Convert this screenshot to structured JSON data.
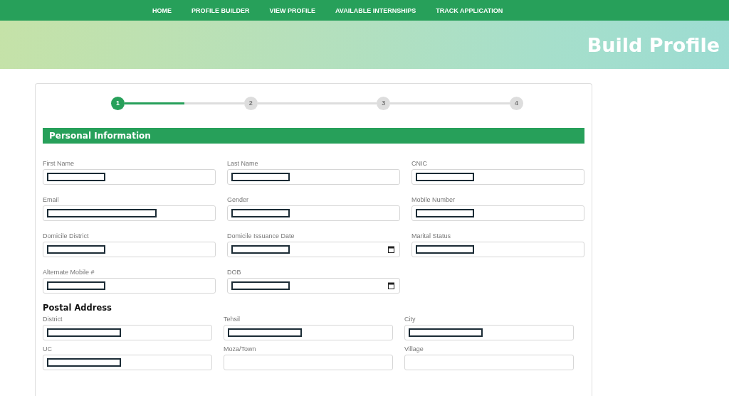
{
  "nav": {
    "items": [
      {
        "label": "HOME"
      },
      {
        "label": "PROFILE BUILDER"
      },
      {
        "label": "VIEW PROFILE"
      },
      {
        "label": "AVAILABLE INTERNSHIPS"
      },
      {
        "label": "TRACK APPLICATION"
      }
    ]
  },
  "banner": {
    "title": "Build Profile"
  },
  "stepper": {
    "steps": [
      {
        "label": "1",
        "selected": true
      },
      {
        "label": "2",
        "selected": false
      },
      {
        "label": "3",
        "selected": false
      },
      {
        "label": "4",
        "selected": false
      }
    ],
    "progress": {
      "level": 0.5
    }
  },
  "personal": {
    "title": "Personal Information",
    "fields": [
      {
        "label": "First Name",
        "kind": "text",
        "redacted": true
      },
      {
        "label": "Last Name",
        "kind": "text",
        "redacted": true
      },
      {
        "label": "CNIC",
        "kind": "text",
        "redacted": true
      },
      {
        "label": "Email",
        "kind": "email",
        "redacted": true
      },
      {
        "label": "Gender",
        "kind": "text",
        "redacted": true
      },
      {
        "label": "Mobile Number",
        "kind": "text",
        "redacted": true
      },
      {
        "label": "Domicile District",
        "kind": "text",
        "redacted": true
      },
      {
        "label": "Domicile Issuance Date",
        "kind": "date",
        "redacted": true
      },
      {
        "label": "Marital Status",
        "kind": "text",
        "redacted": true
      },
      {
        "label": "Alternate Mobile #",
        "kind": "text",
        "redacted": true
      },
      {
        "label": "DOB",
        "kind": "date",
        "redacted": true
      }
    ]
  },
  "postal": {
    "title": "Postal Address",
    "fields": [
      {
        "label": "District",
        "kind": "text",
        "redacted": true
      },
      {
        "label": "Tehsil",
        "kind": "text",
        "redacted": true
      },
      {
        "label": "City",
        "kind": "text",
        "redacted": true
      },
      {
        "label": "UC",
        "kind": "text",
        "redacted": true
      },
      {
        "label": "Moza/Town",
        "kind": "text",
        "redacted": false
      },
      {
        "label": "Village",
        "kind": "text",
        "redacted": false
      }
    ]
  }
}
